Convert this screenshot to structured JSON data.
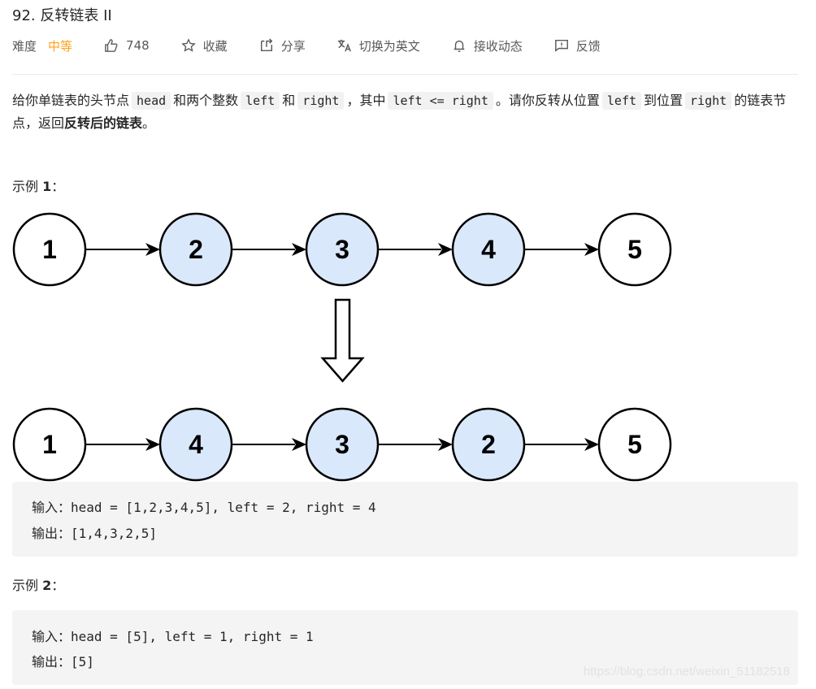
{
  "problem": {
    "title": "92. 反转链表 II"
  },
  "toolbar": {
    "difficulty_label": "难度",
    "difficulty_value": "中等",
    "like_count": "748",
    "favorite_label": "收藏",
    "share_label": "分享",
    "translate_label": "切换为英文",
    "subscribe_label": "接收动态",
    "feedback_label": "反馈"
  },
  "colors": {
    "difficulty_medium": "#ffa116",
    "node_highlight": "#dae8fc",
    "code_bg": "#f4f4f4"
  },
  "description": {
    "p1": "给你单链表的头节点",
    "c_head": "head",
    "p2": "和两个整数",
    "c_left": "left",
    "p3": "和",
    "c_right": "right",
    "p4": "，其中",
    "c_cond": "left <= right",
    "p5": "。请你反转从位置",
    "c_left2": "left",
    "p6": "到位置",
    "c_right2": "right",
    "p7": "的链表节点，返回",
    "bold": "反转后的链表",
    "p8": "。"
  },
  "examples": [
    {
      "label_prefix": "示例",
      "label_num": "1",
      "label_suffix": "：",
      "before": [
        {
          "value": "1",
          "highlight": false
        },
        {
          "value": "2",
          "highlight": true
        },
        {
          "value": "3",
          "highlight": true
        },
        {
          "value": "4",
          "highlight": true
        },
        {
          "value": "5",
          "highlight": false
        }
      ],
      "after": [
        {
          "value": "1",
          "highlight": false
        },
        {
          "value": "4",
          "highlight": true
        },
        {
          "value": "3",
          "highlight": true
        },
        {
          "value": "2",
          "highlight": true
        },
        {
          "value": "5",
          "highlight": false
        }
      ],
      "input": "输入：head = [1,2,3,4,5], left = 2, right = 4",
      "output": "输出：[1,4,3,2,5]"
    },
    {
      "label_prefix": "示例",
      "label_num": "2",
      "label_suffix": "：",
      "input": "输入：head = [5], left = 1, right = 1",
      "output": "输出：[5]"
    }
  ],
  "watermark": "https://blog.csdn.net/weixin_51182518"
}
